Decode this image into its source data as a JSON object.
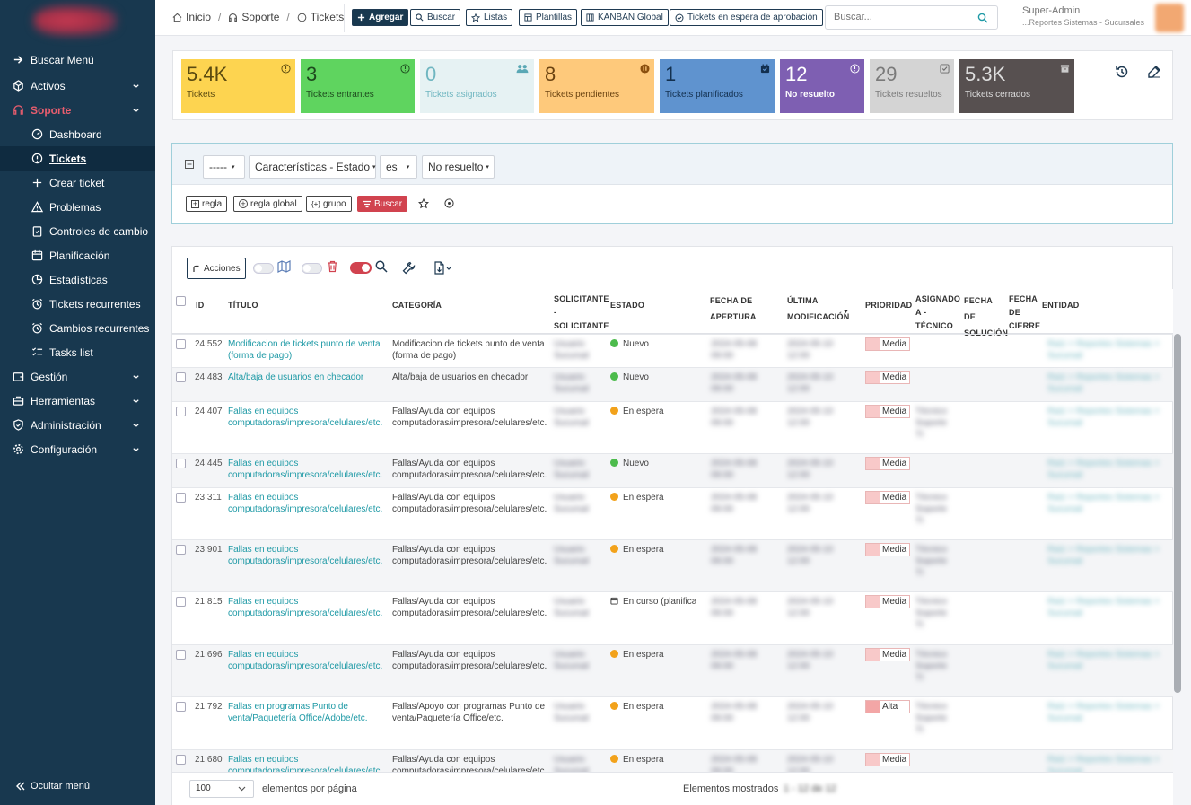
{
  "sidebar": {
    "items": [
      {
        "label": "Buscar Menú",
        "icon": "arrow-right-icon"
      },
      {
        "label": "Activos",
        "icon": "cube-icon"
      },
      {
        "label": "Soporte",
        "icon": "headset-icon"
      },
      {
        "label": "Gestión",
        "icon": "wallet-icon"
      },
      {
        "label": "Herramientas",
        "icon": "briefcase-icon"
      },
      {
        "label": "Administración",
        "icon": "shield-check-icon"
      },
      {
        "label": "Configuración",
        "icon": "gear-icon"
      }
    ],
    "sub": [
      {
        "label": "Dashboard",
        "icon": "dashboard-icon"
      },
      {
        "label": "Tickets",
        "icon": "alert-circle-icon"
      },
      {
        "label": "Crear ticket",
        "icon": "plus-icon"
      },
      {
        "label": "Problemas",
        "icon": "warning-icon"
      },
      {
        "label": "Controles de cambio",
        "icon": "clipboard-check-icon"
      },
      {
        "label": "Planificación",
        "icon": "calendar-icon"
      },
      {
        "label": "Estadísticas",
        "icon": "chart-pie-icon"
      },
      {
        "label": "Tickets recurrentes",
        "icon": "alarm-clock-icon"
      },
      {
        "label": "Cambios recurrentes",
        "icon": "alarm-clock-icon"
      },
      {
        "label": "Tasks list",
        "icon": "list-check-icon"
      }
    ],
    "hide_menu": "Ocultar menú"
  },
  "breadcrumb": {
    "home": "Inicio",
    "support": "Soporte",
    "tickets": "Tickets"
  },
  "toolbar": {
    "add": "Agregar",
    "search": "Buscar",
    "lists": "Listas",
    "templates": "Plantillas",
    "kanban": "KANBAN Global",
    "waiting": "Tickets en espera de aprobación"
  },
  "search_placeholder": "Buscar...",
  "user": {
    "name": "Super-Admin",
    "entity": "...Reportes Sistemas - Sucursales"
  },
  "tiles": [
    {
      "num": "5.4K",
      "label": "Tickets",
      "color": "#fdd450",
      "text": "#5a4a10"
    },
    {
      "num": "3",
      "label": "Tickets entrantes",
      "color": "#5fd45f",
      "text": "#1e4a1e"
    },
    {
      "num": "0",
      "label": "Tickets asignados",
      "color": "#e6f2f3",
      "text": "#6fb6c0"
    },
    {
      "num": "8",
      "label": "Tickets pendientes",
      "color": "#fec97b",
      "text": "#6a4210"
    },
    {
      "num": "1",
      "label": "Tickets planificados",
      "color": "#5f93cf",
      "text": "#13304f"
    },
    {
      "num": "12",
      "label": "No resuelto",
      "color": "#7e5fb2",
      "text": "#ffffff"
    },
    {
      "num": "29",
      "label": "Tickets resueltos",
      "color": "#d4d4d4",
      "text": "#7a7a7a"
    },
    {
      "num": "5.3K",
      "label": "Tickets cerrados",
      "color": "#575050",
      "text": "#dddddd"
    }
  ],
  "filter": {
    "op": "-----",
    "field": "Características - Estado",
    "cmp": "es",
    "value": "No resuelto",
    "rule": "regla",
    "global_rule": "regla global",
    "group": "grupo",
    "search": "Buscar"
  },
  "actions": "Acciones",
  "columns": [
    "ID",
    "TÍTULO",
    "CATEGORÍA",
    "SOLICITANTE - SOLICITANTE",
    "ESTADO",
    "FECHA DE APERTURA",
    "ÚLTIMA MODIFICACIÓN",
    "PRIORIDAD",
    "ASIGNADO A - TÉCNICO",
    "FECHA DE SOLUCIÓN",
    "FECHA DE CIERRE",
    "ENTIDAD"
  ],
  "rows": [
    {
      "id": "24 552",
      "title": "Modificacion de tickets punto de venta (forma de pago)",
      "category": "Modificacion de tickets punto de venta (forma de pago)",
      "status": "Nuevo",
      "status_color": "#4cbb4c",
      "priority": "Media"
    },
    {
      "id": "24 483",
      "title": "Alta/baja de usuarios en checador",
      "category": "Alta/baja de usuarios en checador",
      "status": "Nuevo",
      "status_color": "#4cbb4c",
      "priority": "Media"
    },
    {
      "id": "24 407",
      "title": "Fallas en equipos computadoras/impresora/celulares/etc.",
      "category": "Fallas/Ayuda con equipos computadoras/impresora/celulares/etc.",
      "status": "En espera",
      "status_color": "#f2a21b",
      "priority": "Media"
    },
    {
      "id": "24 445",
      "title": "Fallas en equipos computadoras/impresora/celulares/etc.",
      "category": "Fallas/Ayuda con equipos computadoras/impresora/celulares/etc.",
      "status": "Nuevo",
      "status_color": "#4cbb4c",
      "priority": "Media"
    },
    {
      "id": "23 311",
      "title": "Fallas en equipos computadoras/impresora/celulares/etc.",
      "category": "Fallas/Ayuda con equipos computadoras/impresora/celulares/etc.",
      "status": "En espera",
      "status_color": "#f2a21b",
      "priority": "Media"
    },
    {
      "id": "23 901",
      "title": "Fallas en equipos computadoras/impresora/celulares/etc.",
      "category": "Fallas/Ayuda con equipos computadoras/impresora/celulares/etc.",
      "status": "En espera",
      "status_color": "#f2a21b",
      "priority": "Media"
    },
    {
      "id": "21 815",
      "title": "Fallas en equipos computadoras/impresora/celulares/etc.",
      "category": "Fallas/Ayuda con equipos computadoras/impresora/celulares/etc.",
      "status": "En curso (planificado)",
      "status_color": "calendar",
      "priority": "Media"
    },
    {
      "id": "21 696",
      "title": "Fallas en equipos computadoras/impresora/celulares/etc.",
      "category": "Fallas/Ayuda con equipos computadoras/impresora/celulares/etc.",
      "status": "En espera",
      "status_color": "#f2a21b",
      "priority": "Media"
    },
    {
      "id": "21 792",
      "title": "Fallas en programas Punto de venta/Paquetería Office/Adobe/etc.",
      "category": "Fallas/Apoyo con programas Punto de venta/Paquetería Office/etc.",
      "status": "En espera",
      "status_color": "#f2a21b",
      "priority": "Alta"
    },
    {
      "id": "21 680",
      "title": "Fallas en equipos computadoras/impresora/celulares/etc.",
      "category": "Fallas/Ayuda con equipos computadoras/impresora/celulares/etc.",
      "status": "En espera",
      "status_color": "#f2a21b",
      "priority": "Media"
    }
  ],
  "footer": {
    "page_size": "100",
    "per_page": "elementos por página",
    "shown": "Elementos mostrados"
  }
}
